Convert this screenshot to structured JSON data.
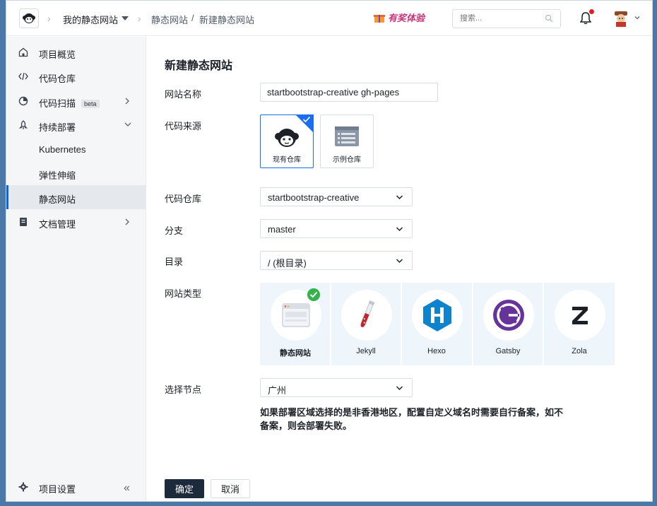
{
  "header": {
    "project_name": "我的静态网站",
    "breadcrumb": [
      "静态网站",
      "新建静态网站"
    ],
    "promo_label": "有奖体验",
    "search_placeholder": "搜索..."
  },
  "sidebar": {
    "items": [
      {
        "label": "项目概览",
        "icon": "home-icon"
      },
      {
        "label": "代码仓库",
        "icon": "code-icon"
      },
      {
        "label": "代码扫描",
        "badge": "beta",
        "icon": "scan-icon"
      },
      {
        "label": "持续部署",
        "icon": "rocket-icon"
      },
      {
        "label": "Kubernetes"
      },
      {
        "label": "弹性伸缩"
      },
      {
        "label": "静态网站",
        "active": true
      },
      {
        "label": "文档管理",
        "icon": "doc-icon"
      }
    ],
    "settings_label": "项目设置"
  },
  "form": {
    "title": "新建静态网站",
    "labels": {
      "site_name": "网站名称",
      "source": "代码来源",
      "repo": "代码仓库",
      "branch": "分支",
      "directory": "目录",
      "site_type": "网站类型",
      "node": "选择节点"
    },
    "site_name_value": "startbootstrap-creative gh-pages",
    "source_options": [
      {
        "label": "现有仓库",
        "selected": true
      },
      {
        "label": "示例仓库",
        "selected": false
      }
    ],
    "repo_value": "startbootstrap-creative",
    "branch_value": "master",
    "directory_value": "/ (根目录)",
    "site_types": [
      {
        "label": "静态网站",
        "selected": true
      },
      {
        "label": "Jekyll"
      },
      {
        "label": "Hexo"
      },
      {
        "label": "Gatsby"
      },
      {
        "label": "Zola"
      }
    ],
    "node_value": "广州",
    "note": "如果部署区域选择的是非香港地区，配置自定义域名时需要自行备案，如不备案，则会部署失败。",
    "confirm_label": "确定",
    "cancel_label": "取消"
  },
  "colors": {
    "accent": "#1a6ef0",
    "primary_button": "#1c2a3b",
    "success": "#35b34a"
  }
}
